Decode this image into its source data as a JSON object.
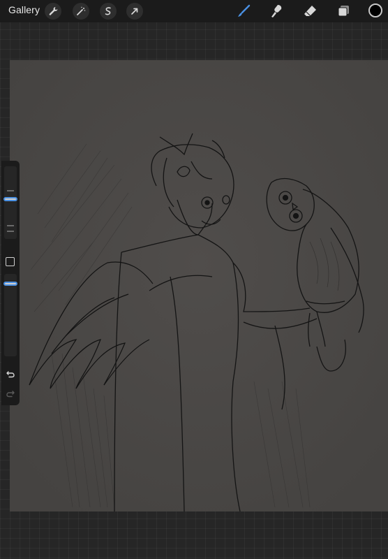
{
  "topbar": {
    "gallery_label": "Gallery",
    "left_tools": [
      {
        "name": "wrench-icon"
      },
      {
        "name": "magic-wand-icon"
      },
      {
        "name": "selection-s-icon"
      },
      {
        "name": "transform-arrow-icon"
      }
    ],
    "right_tools": [
      {
        "name": "brush-icon",
        "active": true
      },
      {
        "name": "smudge-icon",
        "active": false
      },
      {
        "name": "eraser-icon",
        "active": false
      },
      {
        "name": "layers-icon",
        "active": false
      }
    ],
    "current_color": "#000000"
  },
  "colors": {
    "accent": "#4a90e2",
    "canvas": "#4a4846",
    "bar": "#1b1b1b"
  },
  "sidebar": {
    "brush_size_level": 0.55,
    "opacity_level": 0.9,
    "undo_icon": "undo-icon",
    "redo_icon": "redo-icon"
  },
  "canvas": {
    "description_icon": "sketch-artwork"
  }
}
